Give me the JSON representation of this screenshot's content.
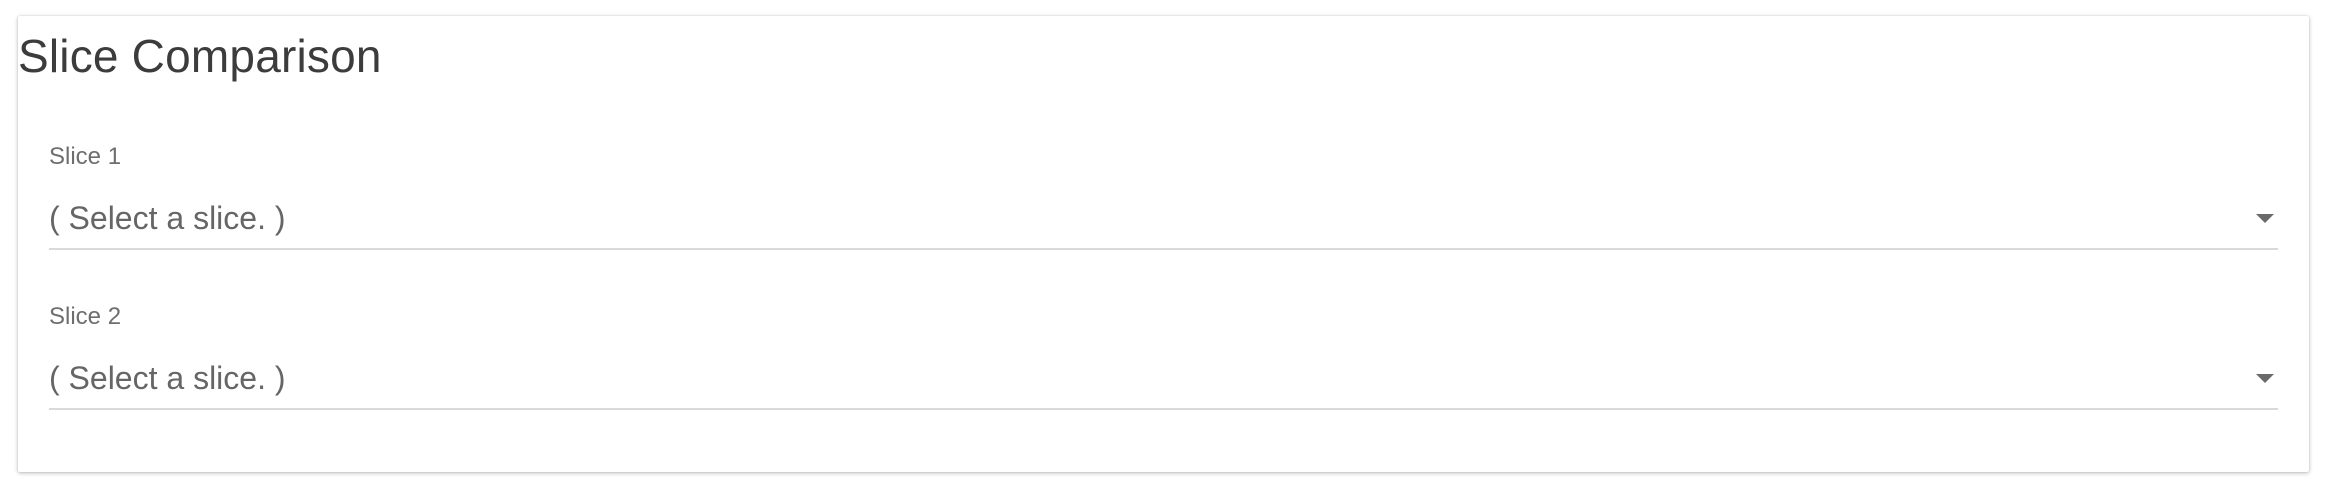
{
  "panel": {
    "title": "Slice Comparison"
  },
  "fields": [
    {
      "label": "Slice 1",
      "value": "( Select a slice. )",
      "icon": "dropdown-arrow-icon"
    },
    {
      "label": "Slice 2",
      "value": "( Select a slice. )",
      "icon": "dropdown-arrow-icon"
    }
  ],
  "colors": {
    "title": "#3c3c3c",
    "label": "#6e6e6e",
    "value": "#666666",
    "underline": "#d9d9d9",
    "icon": "#6a6a6a"
  }
}
